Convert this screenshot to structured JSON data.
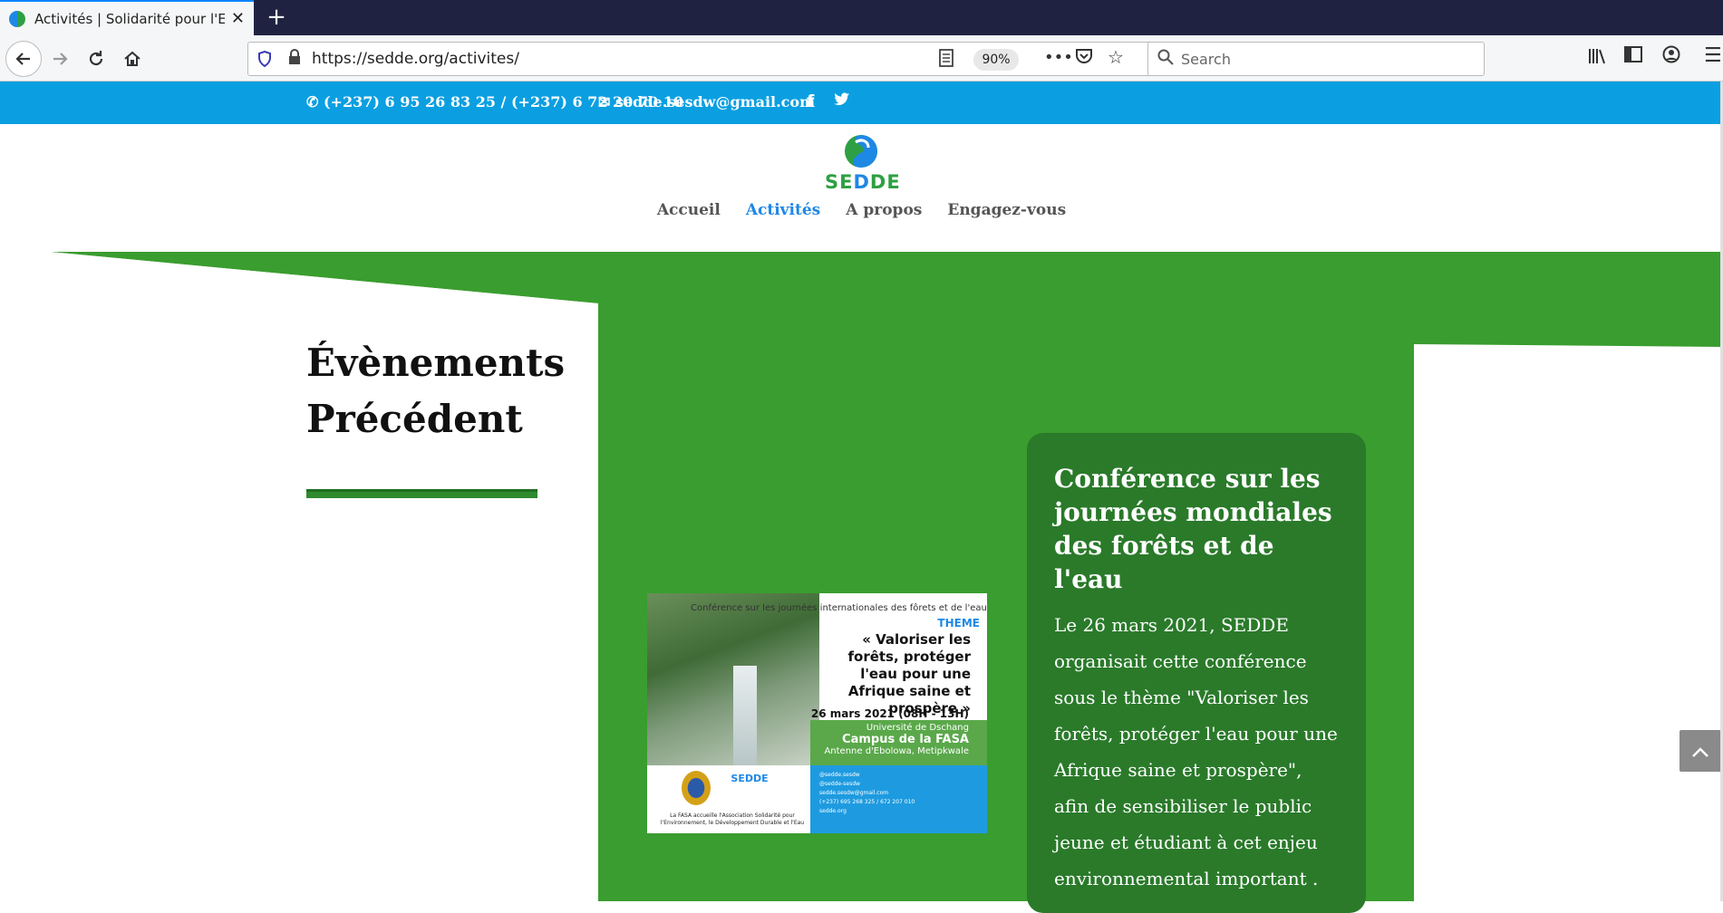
{
  "browser": {
    "tab_title": "Activités | Solidarité pour l'Envi",
    "new_tab_symbol": "+",
    "close_symbol": "✕",
    "url": "https://sedde.org/activites/",
    "zoom": "90%",
    "search_placeholder": "Search"
  },
  "topbar": {
    "phone": "(+237) 6 95 26 83 25 / (+237) 6 72 20 70 10",
    "email": "sedde.sesdw@gmail.com",
    "facebook": "f",
    "twitter": "🐦"
  },
  "header": {
    "logo_text_1": "SE",
    "logo_text_2": "D",
    "logo_text_3": "DE",
    "menu": [
      {
        "label": "Accueil",
        "active": false
      },
      {
        "label": "Activités",
        "active": true
      },
      {
        "label": "A propos",
        "active": false
      },
      {
        "label": "Engagez-vous",
        "active": false
      }
    ]
  },
  "main": {
    "section_title_line1": "Évènements",
    "section_title_line2": "Précédent",
    "event_image": {
      "header": "Conférence sur les journées internationales des fôrets et de l'eau",
      "theme_label": "THEME",
      "quote": "« Valoriser les forêts, protéger l'eau pour une Afrique saine et prospère »",
      "date": "26 mars 2021 (08H - 13H)",
      "university": "Université de Dschang",
      "campus": "Campus de la FASA",
      "antenna": "Antenne d'Ebolowa, Metipkwale",
      "sedde": "SEDDE",
      "caption": "La FASA accueille l'Association Solidarité pour l'Environnement, le Développement Durable et l'Eau",
      "contacts": [
        "@sedde.sesdw",
        "@sedde-sesdw",
        "sedde.sesdw@gmail.com",
        "(+237) 695 268 325 / 672 207 010",
        "sedde.org"
      ]
    },
    "card_title": "Conférence sur les journées mondiales des forêts et de l'eau",
    "card_body": "Le 26 mars 2021, SEDDE organisait cette conférence sous le thème \"Valoriser les forêts, protéger l'eau pour une Afrique saine et prospère\", afin de sensibiliser le public jeune et étudiant à cet enjeu environnemental important ."
  },
  "colors": {
    "topbar": "#0b9fe1",
    "green": "#3a9d2f",
    "card_green": "#2a7a2a",
    "accent_blue": "#1e88e5"
  }
}
